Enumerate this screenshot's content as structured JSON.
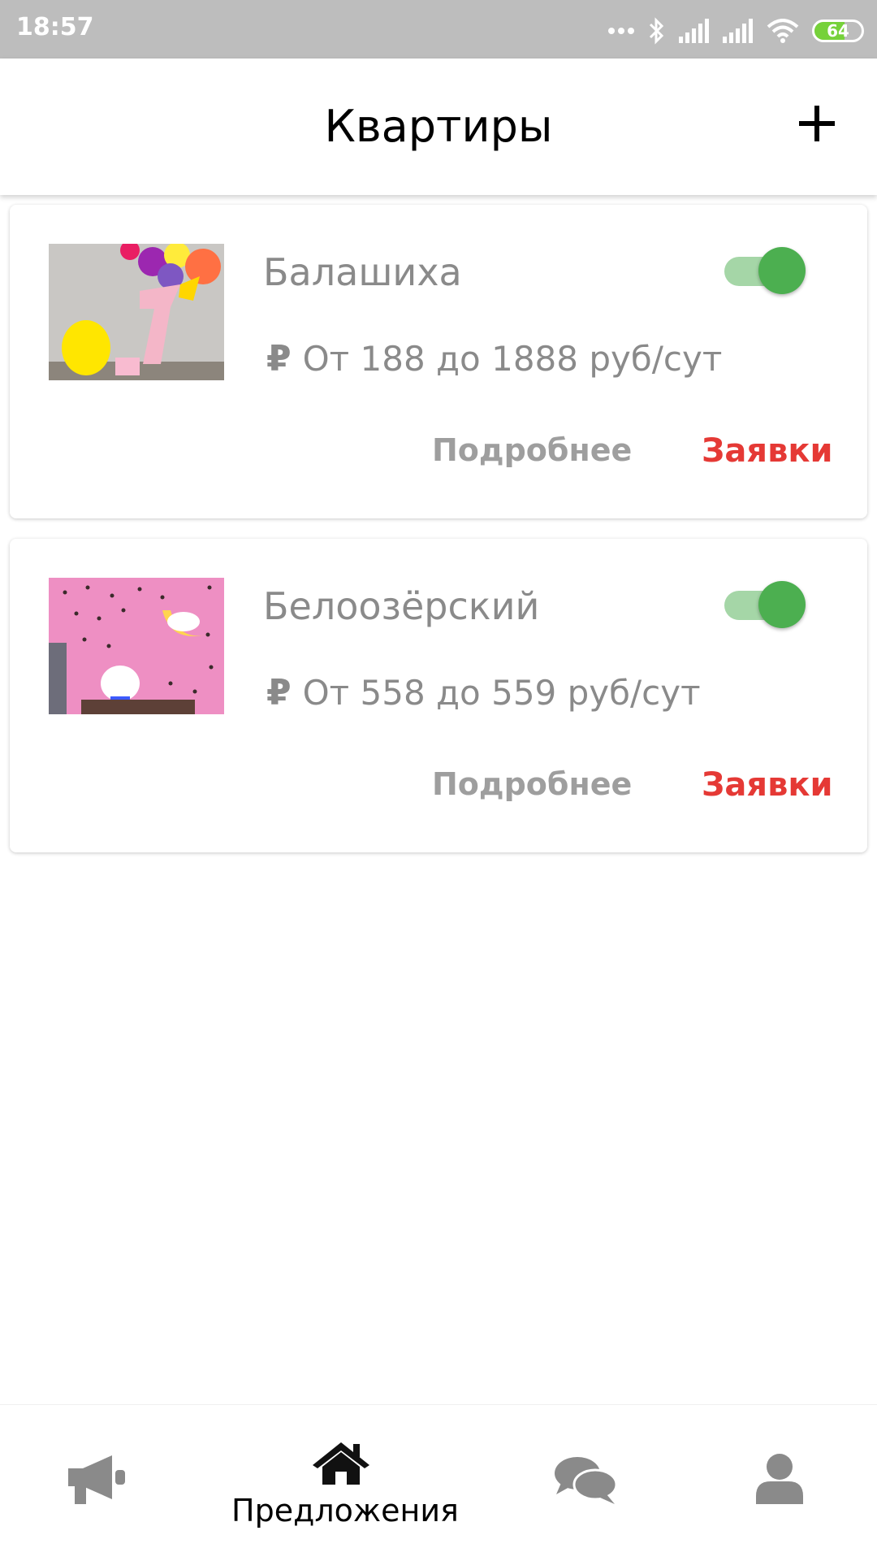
{
  "status_bar": {
    "time": "18:57",
    "battery": "64",
    "icons": [
      "more-dots-icon",
      "bluetooth-icon",
      "signal-icon",
      "signal-icon",
      "wifi-icon",
      "battery-icon"
    ]
  },
  "app_bar": {
    "title": "Квартиры",
    "add_icon": "plus-icon"
  },
  "listings": [
    {
      "name": "Балашиха",
      "currency_symbol": "₽",
      "price": "От 188 до 1888 руб/сут",
      "active": true,
      "details_label": "Подробнее",
      "requests_label": "Заявки"
    },
    {
      "name": "Белоозёрский",
      "currency_symbol": "₽",
      "price": "От 558 до 559 руб/сут",
      "active": true,
      "details_label": "Подробнее",
      "requests_label": "Заявки"
    }
  ],
  "bottom_nav": {
    "items": [
      {
        "icon": "megaphone-icon",
        "label": ""
      },
      {
        "icon": "home-icon",
        "label": "Предложения",
        "selected": true
      },
      {
        "icon": "chat-icon",
        "label": ""
      },
      {
        "icon": "user-icon",
        "label": ""
      }
    ]
  },
  "colors": {
    "accent_green": "#4caf50",
    "track_green": "#a5d6a7",
    "requests_red": "#e53935",
    "muted_text": "#8a8a8a",
    "status_bar": "#bdbdbd"
  }
}
